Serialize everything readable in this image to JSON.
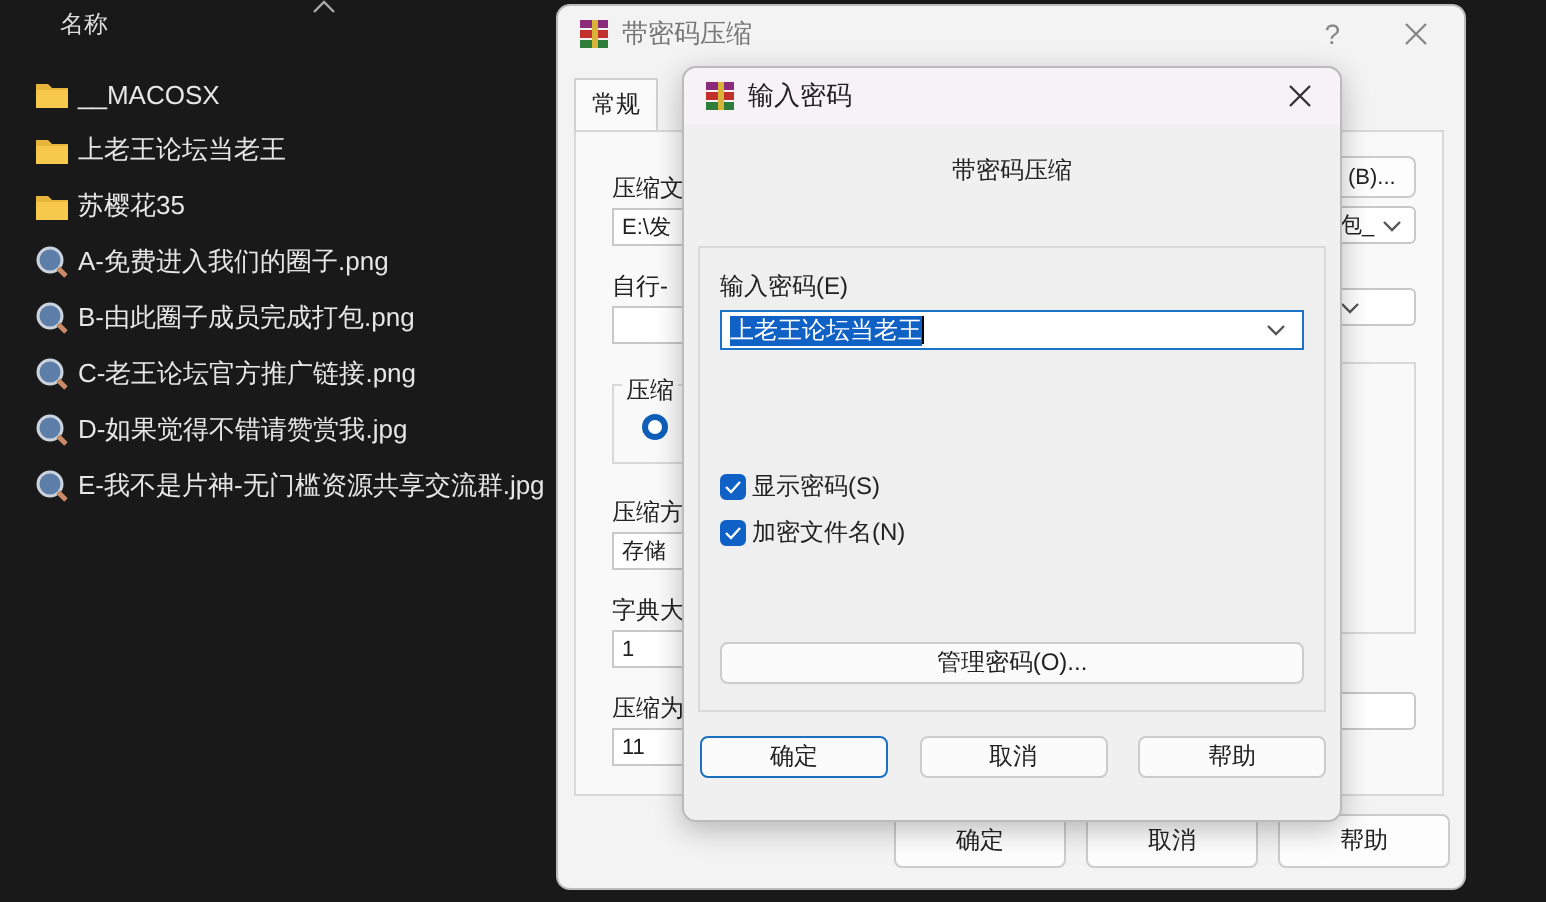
{
  "explorer": {
    "column_header": "名称",
    "items": [
      {
        "kind": "folder",
        "name": "__MACOSX"
      },
      {
        "kind": "folder",
        "name": "上老王论坛当老王"
      },
      {
        "kind": "folder",
        "name": "苏樱花35"
      },
      {
        "kind": "image",
        "name": "A-免费进入我们的圈子.png"
      },
      {
        "kind": "image",
        "name": "B-由此圈子成员完成打包.png"
      },
      {
        "kind": "image",
        "name": "C-老王论坛官方推广链接.png"
      },
      {
        "kind": "image",
        "name": "D-如果觉得不错请赞赏我.jpg"
      },
      {
        "kind": "image",
        "name": "E-我不是片神-无门槛资源共享交流群.jpg"
      }
    ]
  },
  "back_dialog": {
    "title": "带密码压缩",
    "help": "?",
    "tabs": [
      {
        "label": "常规",
        "selected": true
      }
    ],
    "left": [
      {
        "kind": "label",
        "text": "压缩文"
      },
      {
        "kind": "field",
        "text": "E:\\发"
      },
      {
        "kind": "label",
        "text": "自行-"
      },
      {
        "kind": "combo"
      },
      {
        "kind": "group",
        "legend": "压缩",
        "radio_selected": true
      },
      {
        "kind": "label",
        "text": "压缩方"
      },
      {
        "kind": "field",
        "text": "存储"
      },
      {
        "kind": "label",
        "text": "字典大"
      },
      {
        "kind": "field",
        "text": "1"
      },
      {
        "kind": "label",
        "text": "压缩为"
      },
      {
        "kind": "field",
        "text": "11"
      }
    ],
    "right": [
      {
        "kind": "button",
        "text": "(B)..."
      },
      {
        "kind": "combo",
        "text": "包_"
      },
      {
        "kind": "combo"
      },
      {
        "kind": "group"
      },
      {
        "kind": "field"
      }
    ],
    "buttons": [
      {
        "label": "确定"
      },
      {
        "label": "取消"
      },
      {
        "label": "帮助"
      }
    ]
  },
  "password_dialog": {
    "title": "输入密码",
    "heading": "带密码压缩",
    "password_label": "输入密码(E)",
    "password_value": "上老王论坛当老王",
    "options": [
      {
        "label": "显示密码(S)",
        "checked": true
      },
      {
        "label": "加密文件名(N)",
        "checked": true
      }
    ],
    "manage_button": "管理密码(O)...",
    "buttons": [
      {
        "label": "确定",
        "default": true
      },
      {
        "label": "取消",
        "default": false
      },
      {
        "label": "帮助",
        "default": false
      }
    ]
  }
}
